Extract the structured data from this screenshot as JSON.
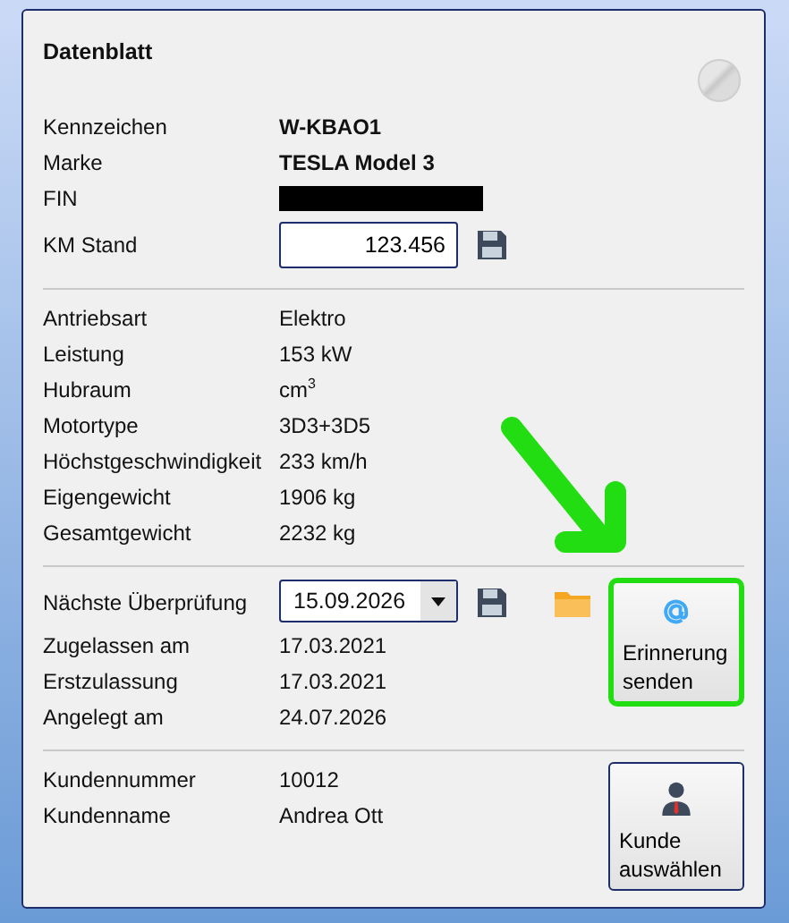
{
  "panel": {
    "title": "Datenblatt",
    "status_button": {
      "disabled": true
    }
  },
  "sections": [
    {
      "rows": [
        {
          "kind": "bold",
          "label": "Kennzeichen",
          "value": "W-KBAO1"
        },
        {
          "kind": "bold",
          "label": "Marke",
          "value": "TESLA Model 3"
        },
        {
          "kind": "redacted",
          "label": "FIN"
        },
        {
          "kind": "input",
          "label": "KM Stand",
          "value": "123.456"
        }
      ]
    },
    {
      "rows": [
        {
          "kind": "text",
          "label": "Antriebsart",
          "value": "Elektro"
        },
        {
          "kind": "text",
          "label": "Leistung",
          "value": "153 kW"
        },
        {
          "kind": "text",
          "label": "Hubraum",
          "value": "cm$^{3}$"
        },
        {
          "kind": "text",
          "label": "Motortype",
          "value": "3D3+3D5"
        },
        {
          "kind": "text",
          "label": "Höchstgeschwindigkeit",
          "value": "233 km/h"
        },
        {
          "kind": "text",
          "label": "Eigengewicht",
          "value": "1906 kg"
        },
        {
          "kind": "text",
          "label": "Gesamtgewicht",
          "value": "2232 kg"
        }
      ]
    },
    {
      "rows": [
        {
          "kind": "date",
          "label": "Nächste Überprüfung",
          "value": "15.09.2026"
        },
        {
          "kind": "text",
          "label": "Zugelassen am",
          "value": "17.03.2021"
        },
        {
          "kind": "text",
          "label": "Erstzulassung",
          "value": "17.03.2021"
        },
        {
          "kind": "text",
          "label": "Angelegt am",
          "value": "24.07.2026"
        }
      ],
      "action": {
        "kind": "mail",
        "label": "Erinnerung senden",
        "highlighted": true
      }
    },
    {
      "rows": [
        {
          "kind": "text",
          "label": "Kundennummer",
          "value": "10012"
        },
        {
          "kind": "text",
          "label": "Kundenname",
          "value": "Andrea Ott"
        }
      ],
      "action": {
        "kind": "person",
        "label": "Kunde auswählen",
        "highlighted": false
      }
    }
  ]
}
